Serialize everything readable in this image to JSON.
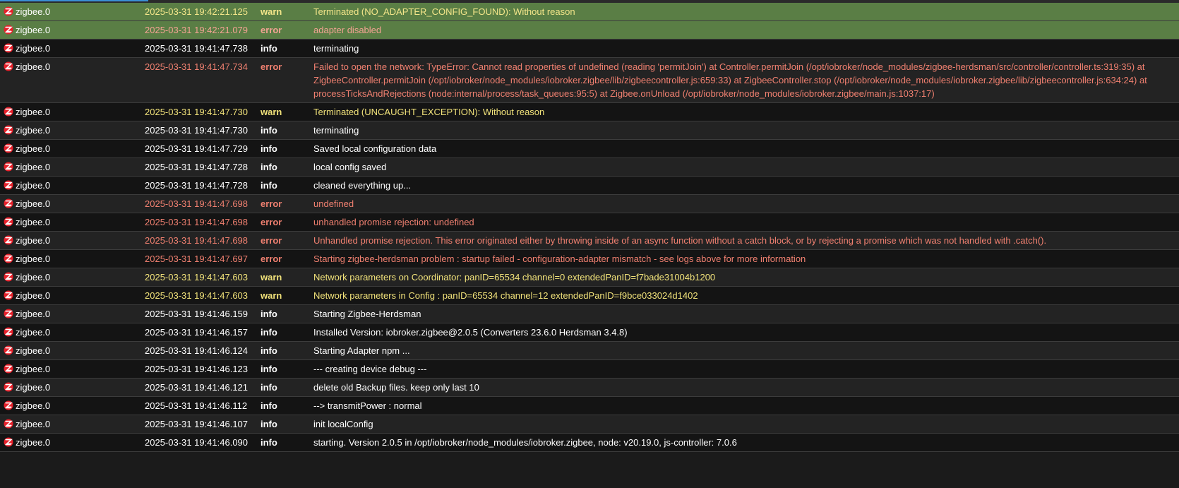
{
  "log": {
    "rows": [
      {
        "source": "zigbee.0",
        "time": "2025-03-31 19:42:21.125",
        "severity": "warn",
        "message": "Terminated (NO_ADAPTER_CONFIG_FOUND): Without reason",
        "highlighted": true
      },
      {
        "source": "zigbee.0",
        "time": "2025-03-31 19:42:21.079",
        "severity": "error",
        "message": "adapter disabled",
        "highlighted": true
      },
      {
        "source": "zigbee.0",
        "time": "2025-03-31 19:41:47.738",
        "severity": "info",
        "message": "terminating"
      },
      {
        "source": "zigbee.0",
        "time": "2025-03-31 19:41:47.734",
        "severity": "error",
        "message": "Failed to open the network: TypeError: Cannot read properties of undefined (reading 'permitJoin') at Controller.permitJoin (/opt/iobroker/node_modules/zigbee-herdsman/src/controller/controller.ts:319:35) at ZigbeeController.permitJoin (/opt/iobroker/node_modules/iobroker.zigbee/lib/zigbeecontroller.js:659:33) at ZigbeeController.stop (/opt/iobroker/node_modules/iobroker.zigbee/lib/zigbeecontroller.js:634:24) at processTicksAndRejections (node:internal/process/task_queues:95:5) at Zigbee.onUnload (/opt/iobroker/node_modules/iobroker.zigbee/main.js:1037:17)"
      },
      {
        "source": "zigbee.0",
        "time": "2025-03-31 19:41:47.730",
        "severity": "warn",
        "message": "Terminated (UNCAUGHT_EXCEPTION): Without reason"
      },
      {
        "source": "zigbee.0",
        "time": "2025-03-31 19:41:47.730",
        "severity": "info",
        "message": "terminating"
      },
      {
        "source": "zigbee.0",
        "time": "2025-03-31 19:41:47.729",
        "severity": "info",
        "message": "Saved local configuration data"
      },
      {
        "source": "zigbee.0",
        "time": "2025-03-31 19:41:47.728",
        "severity": "info",
        "message": "local config saved"
      },
      {
        "source": "zigbee.0",
        "time": "2025-03-31 19:41:47.728",
        "severity": "info",
        "message": "cleaned everything up..."
      },
      {
        "source": "zigbee.0",
        "time": "2025-03-31 19:41:47.698",
        "severity": "error",
        "message": "undefined"
      },
      {
        "source": "zigbee.0",
        "time": "2025-03-31 19:41:47.698",
        "severity": "error",
        "message": "unhandled promise rejection: undefined"
      },
      {
        "source": "zigbee.0",
        "time": "2025-03-31 19:41:47.698",
        "severity": "error",
        "message": "Unhandled promise rejection. This error originated either by throwing inside of an async function without a catch block, or by rejecting a promise which was not handled with .catch()."
      },
      {
        "source": "zigbee.0",
        "time": "2025-03-31 19:41:47.697",
        "severity": "error",
        "message": "Starting zigbee-herdsman problem : startup failed - configuration-adapter mismatch - see logs above for more information"
      },
      {
        "source": "zigbee.0",
        "time": "2025-03-31 19:41:47.603",
        "severity": "warn",
        "message": "Network parameters on Coordinator: panID=65534 channel=0 extendedPanID=f7bade31004b1200"
      },
      {
        "source": "zigbee.0",
        "time": "2025-03-31 19:41:47.603",
        "severity": "warn",
        "message": "Network parameters in Config : panID=65534 channel=12 extendedPanID=f9bce033024d1402"
      },
      {
        "source": "zigbee.0",
        "time": "2025-03-31 19:41:46.159",
        "severity": "info",
        "message": "Starting Zigbee-Herdsman"
      },
      {
        "source": "zigbee.0",
        "time": "2025-03-31 19:41:46.157",
        "severity": "info",
        "message": "Installed Version: iobroker.zigbee@2.0.5 (Converters 23.6.0 Herdsman 3.4.8)"
      },
      {
        "source": "zigbee.0",
        "time": "2025-03-31 19:41:46.124",
        "severity": "info",
        "message": "Starting Adapter npm ..."
      },
      {
        "source": "zigbee.0",
        "time": "2025-03-31 19:41:46.123",
        "severity": "info",
        "message": "--- creating device debug ---"
      },
      {
        "source": "zigbee.0",
        "time": "2025-03-31 19:41:46.121",
        "severity": "info",
        "message": "delete old Backup files. keep only last 10"
      },
      {
        "source": "zigbee.0",
        "time": "2025-03-31 19:41:46.112",
        "severity": "info",
        "message": "--> transmitPower : normal"
      },
      {
        "source": "zigbee.0",
        "time": "2025-03-31 19:41:46.107",
        "severity": "info",
        "message": "init localConfig"
      },
      {
        "source": "zigbee.0",
        "time": "2025-03-31 19:41:46.090",
        "severity": "info",
        "message": "starting. Version 2.0.5 in /opt/iobroker/node_modules/iobroker.zigbee, node: v20.19.0, js-controller: 7.0.6"
      }
    ]
  },
  "colors": {
    "info": "#ffffff",
    "warn": "#f1e27a",
    "error": "#f08070",
    "highlight_row": "#5a7e45",
    "zigbee_icon": "#e8202a"
  },
  "icons": {
    "source": "zigbee-logo-icon"
  }
}
